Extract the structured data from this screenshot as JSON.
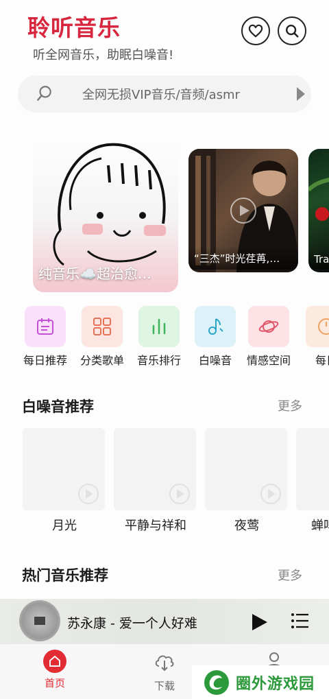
{
  "header": {
    "title": "聆听音乐",
    "subtitle": "听全网音乐，助眠白噪音!",
    "favorite_icon": "heart-icon",
    "search_icon": "search-icon"
  },
  "search": {
    "placeholder": "全网无损VIP音乐/音频/asmr"
  },
  "carousel": {
    "items": [
      {
        "caption": "纯音乐☁️超治愈…"
      },
      {
        "caption": "“三杰”时光荏苒,…"
      },
      {
        "caption": "Tra"
      }
    ]
  },
  "categories": {
    "items": [
      {
        "label": "每日推荐",
        "icon": "calendar-icon",
        "color": "#c54fd6",
        "bg": "#fbe0fb"
      },
      {
        "label": "分类歌单",
        "icon": "grid-icon",
        "color": "#e57158",
        "bg": "#fde5e0"
      },
      {
        "label": "音乐排行",
        "icon": "bar-chart-icon",
        "color": "#3fb35a",
        "bg": "#ddf5e2"
      },
      {
        "label": "白噪音",
        "icon": "music-note-icon",
        "color": "#2aa5c7",
        "bg": "#dcf2f8"
      },
      {
        "label": "情感空间",
        "icon": "planet-icon",
        "color": "#e0566b",
        "bg": "#fde3e5"
      },
      {
        "label": "每日",
        "icon": "clock-icon",
        "color": "#f0a060",
        "bg": "#fdeade"
      }
    ]
  },
  "white_noise": {
    "title": "白噪音推荐",
    "more": "更多",
    "items": [
      {
        "label": "月光"
      },
      {
        "label": "平静与祥和"
      },
      {
        "label": "夜莺"
      },
      {
        "label": "蝉鸣"
      }
    ]
  },
  "hot_music": {
    "title": "热门音乐推荐",
    "more": "更多"
  },
  "player": {
    "track": "苏永康 - 爱一个人好难"
  },
  "tabbar": {
    "home": "首页",
    "download": "下载",
    "me": "我的"
  },
  "watermark": {
    "text": "圈外游戏园"
  },
  "colors": {
    "brand": "#d7263d",
    "home_tab": "#e12b35",
    "watermark": "#2c9a3a"
  }
}
